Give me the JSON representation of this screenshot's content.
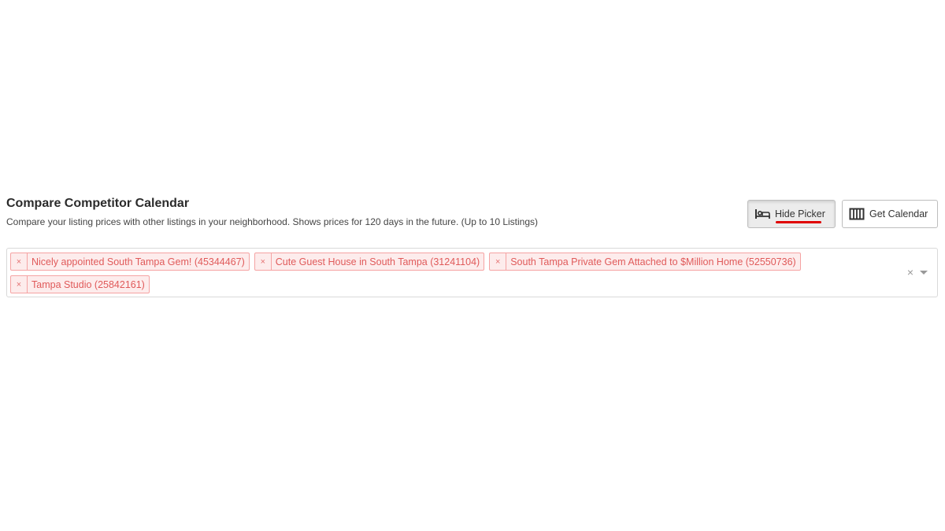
{
  "header": {
    "title": "Compare Competitor Calendar",
    "subtitle": "Compare your listing prices with other listings in your neighborhood. Shows prices for 120 days in the future. (Up to 10 Listings)"
  },
  "toolbar": {
    "hide_picker_label": "Hide Picker",
    "hide_picker_icon": "bed-icon",
    "get_calendar_label": "Get Calendar",
    "get_calendar_icon": "calendar-columns-icon"
  },
  "picker": {
    "tags": [
      {
        "label": "Nicely appointed South Tampa Gem! (45344467)",
        "remove": "×"
      },
      {
        "label": "Cute Guest House in South Tampa (31241104)",
        "remove": "×"
      },
      {
        "label": "South Tampa Private Gem Attached to $Million Home (52550736)",
        "remove": "×"
      },
      {
        "label": "Tampa Studio (25842161)",
        "remove": "×"
      }
    ],
    "clear_all": "×",
    "dropdown_icon": "chevron-down-icon"
  },
  "colors": {
    "tag_text": "#e05a5a",
    "tag_background": "#fdecec",
    "tag_border": "#f5a3a3",
    "underline_accent": "#e00000"
  }
}
